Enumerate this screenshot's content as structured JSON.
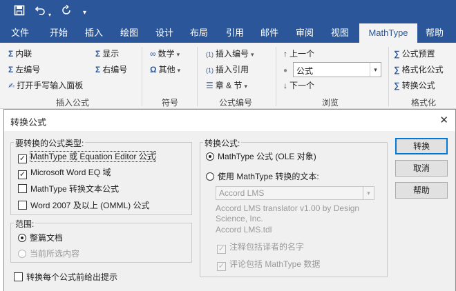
{
  "qat": {
    "save_icon": "save-icon",
    "undo_icon": "undo-icon",
    "redo_icon": "redo-icon",
    "customize_icon": "customize-icon"
  },
  "tabs": [
    "文件",
    "开始",
    "插入",
    "绘图",
    "设计",
    "布局",
    "引用",
    "邮件",
    "审阅",
    "视图",
    "MathType",
    "帮助"
  ],
  "active_tab": "MathType",
  "ribbon": {
    "insert_group": {
      "label": "插入公式",
      "inline": "内联",
      "display": "显示",
      "left_number": "左编号",
      "right_number": "右编号",
      "handwriting": "打开手写输入面板"
    },
    "symbol_group": {
      "label": "符号",
      "math": "数学",
      "other": "其他"
    },
    "numbering_group": {
      "label": "公式编号",
      "insert_number": "插入编号",
      "insert_reference": "插入引用",
      "chapter_section": "章 & 节",
      "number_tag_1": "(1)",
      "number_tag_2": "(1)"
    },
    "browse_group": {
      "label": "浏览",
      "previous": "上一个",
      "type_value": "公式",
      "next": "下一个"
    },
    "format_group": {
      "label": "格式化",
      "preset": "公式预置",
      "format": "格式化公式",
      "convert": "转换公式"
    }
  },
  "dialog": {
    "title": "转换公式",
    "close_glyph": "✕",
    "types_group": {
      "legend": "要转换的公式类型:",
      "items": [
        {
          "label": "MathType 或 Equation Editor 公式",
          "checked": true
        },
        {
          "label": "Microsoft Word EQ 域",
          "checked": true
        },
        {
          "label": "MathType 转换文本公式",
          "checked": false
        },
        {
          "label": "Word 2007 及以上 (OMML) 公式",
          "checked": false
        }
      ]
    },
    "range_group": {
      "legend": "范围:",
      "whole_doc": "整篇文档",
      "selection": "当前所选内容"
    },
    "prompt_each": "转换每个公式前给出提示",
    "convert_group": {
      "legend": "转换公式:",
      "ole": "MathType 公式 (OLE 对象)",
      "text": "使用 MathType 转换的文本:",
      "translator": "Accord LMS",
      "translator_desc": "Accord LMS translator v1.00 by Design Science, Inc.",
      "translator_file": "Accord LMS.tdl",
      "include_comment": "注释包括译者的名字",
      "include_data": "评论包括 MathType 数据"
    },
    "buttons": {
      "convert": "转换",
      "cancel": "取消",
      "help": "帮助"
    }
  }
}
